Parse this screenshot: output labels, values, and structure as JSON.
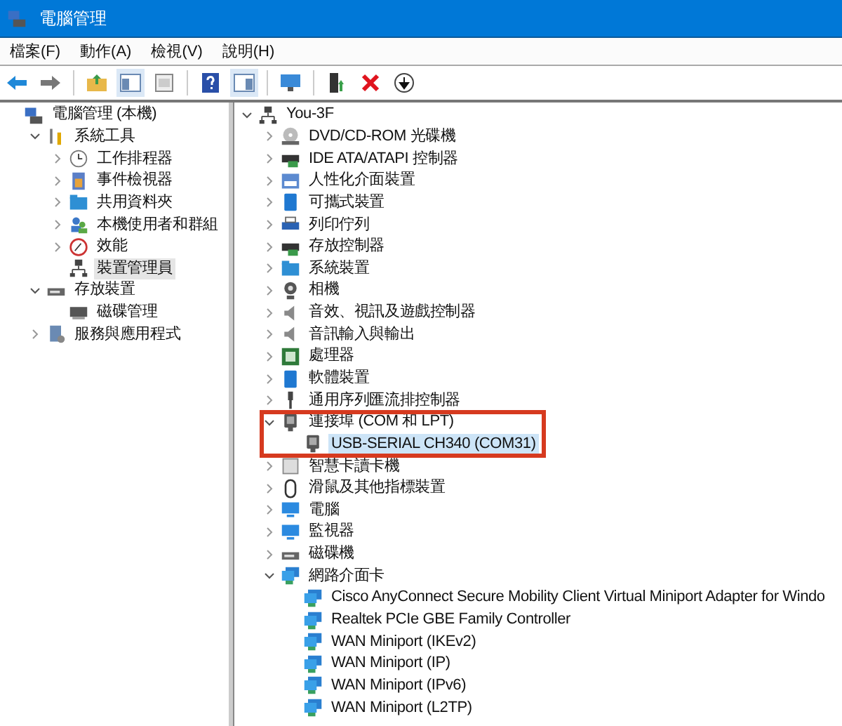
{
  "window": {
    "title": "電腦管理"
  },
  "menu": [
    {
      "label": "檔案(F)"
    },
    {
      "label": "動作(A)"
    },
    {
      "label": "檢視(V)"
    },
    {
      "label": "說明(H)"
    }
  ],
  "left_tree": [
    {
      "label": "電腦管理 (本機)",
      "selected": false,
      "children": [
        {
          "label": "系統工具",
          "expanded": true,
          "selected": false,
          "children": [
            {
              "label": "工作排程器",
              "expanded": false,
              "selected": false
            },
            {
              "label": "事件檢視器",
              "expanded": false,
              "selected": false
            },
            {
              "label": "共用資料夾",
              "expanded": false,
              "selected": false
            },
            {
              "label": "本機使用者和群組",
              "expanded": false,
              "selected": false
            },
            {
              "label": "效能",
              "expanded": false,
              "selected": false
            },
            {
              "label": "裝置管理員",
              "selected": true
            }
          ]
        },
        {
          "label": "存放裝置",
          "expanded": true,
          "selected": false,
          "children": [
            {
              "label": "磁碟管理",
              "selected": false
            }
          ]
        },
        {
          "label": "服務與應用程式",
          "expanded": false,
          "selected": false
        }
      ]
    }
  ],
  "device_tree": [
    {
      "label": "You-3F",
      "expanded": true,
      "selected": false,
      "children": [
        {
          "label": "DVD/CD-ROM 光碟機",
          "expanded": false,
          "selected": false
        },
        {
          "label": "IDE ATA/ATAPI 控制器",
          "expanded": false,
          "selected": false
        },
        {
          "label": "人性化介面裝置",
          "expanded": false,
          "selected": false
        },
        {
          "label": "可攜式裝置",
          "expanded": false,
          "selected": false
        },
        {
          "label": "列印佇列",
          "expanded": false,
          "selected": false
        },
        {
          "label": "存放控制器",
          "expanded": false,
          "selected": false
        },
        {
          "label": "系統裝置",
          "expanded": false,
          "selected": false
        },
        {
          "label": "相機",
          "expanded": false,
          "selected": false
        },
        {
          "label": "音效、視訊及遊戲控制器",
          "expanded": false,
          "selected": false
        },
        {
          "label": "音訊輸入與輸出",
          "expanded": false,
          "selected": false
        },
        {
          "label": "處理器",
          "expanded": false,
          "selected": false
        },
        {
          "label": "軟體裝置",
          "expanded": false,
          "selected": false
        },
        {
          "label": "通用序列匯流排控制器",
          "expanded": false,
          "selected": false
        },
        {
          "label": "連接埠 (COM 和 LPT)",
          "expanded": true,
          "selected": false,
          "children": [
            {
              "label": "USB-SERIAL CH340 (COM31)",
              "selected": true
            }
          ]
        },
        {
          "label": "智慧卡讀卡機",
          "expanded": false,
          "selected": false
        },
        {
          "label": "滑鼠及其他指標裝置",
          "expanded": false,
          "selected": false
        },
        {
          "label": "電腦",
          "expanded": false,
          "selected": false
        },
        {
          "label": "監視器",
          "expanded": false,
          "selected": false
        },
        {
          "label": "磁碟機",
          "expanded": false,
          "selected": false
        },
        {
          "label": "網路介面卡",
          "expanded": true,
          "selected": false,
          "children": [
            {
              "label": "Cisco AnyConnect Secure Mobility Client Virtual Miniport Adapter for Windo",
              "selected": false
            },
            {
              "label": "Realtek PCIe GBE Family Controller",
              "selected": false
            },
            {
              "label": "WAN Miniport (IKEv2)",
              "selected": false
            },
            {
              "label": "WAN Miniport (IP)",
              "selected": false
            },
            {
              "label": "WAN Miniport (IPv6)",
              "selected": false
            },
            {
              "label": "WAN Miniport (L2TP)",
              "selected": false
            }
          ]
        }
      ]
    }
  ]
}
